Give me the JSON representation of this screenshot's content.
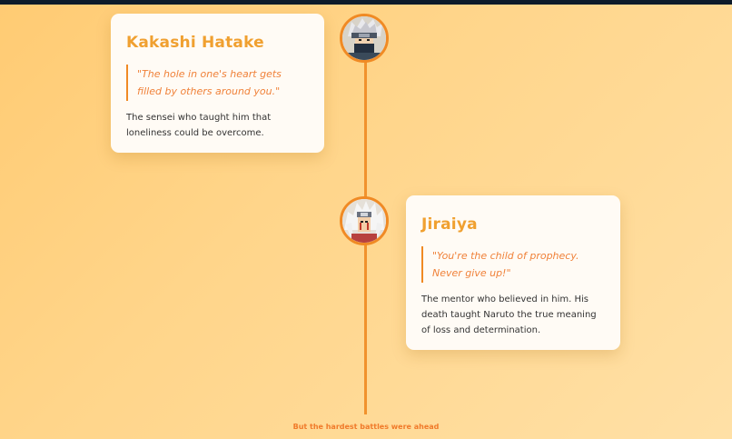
{
  "top_bar": {
    "text": "..."
  },
  "timeline": {
    "entries": [
      {
        "name": "Kakashi Hatake",
        "quote": "\"The hole in one's heart gets filled by others around you.\"",
        "description": "The sensei who taught him that loneliness could be overcome.",
        "avatar_icon": "kakashi-avatar-icon"
      },
      {
        "name": "Jiraiya",
        "quote": "\"You're the child of prophecy. Never give up!\"",
        "description": "The mentor who believed in him. His death taught Naruto the true meaning of loss and determination.",
        "avatar_icon": "jiraiya-avatar-icon"
      }
    ],
    "footer": "But the hardest battles were ahead"
  },
  "colors": {
    "accent": "#f08a24",
    "name": "#f0a030",
    "quote": "#f0823a",
    "line": "#f1922d",
    "top_bar": "#0d1b2a"
  }
}
